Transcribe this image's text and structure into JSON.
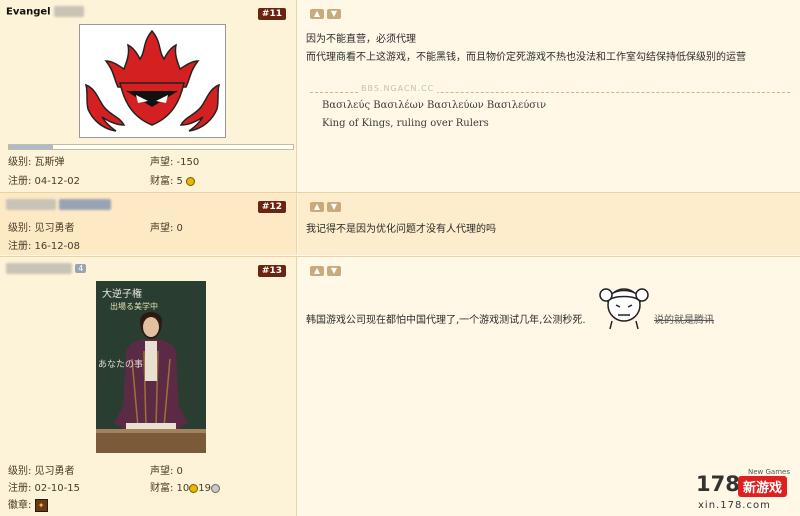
{
  "posts": [
    {
      "floor": "#11",
      "username": "Evangel",
      "level_label": "级别: 瓦斯弹",
      "reputation_label": "声望: -150",
      "register_label": "注册: 04-12-02",
      "wealth_label": "财富: 5",
      "content_lines": [
        "因为不能直营，必须代理",
        "而代理商看不上这游戏，不能黑钱，而且物价定死游戏不热也没法和工作室勾结保持低保级别的运营"
      ],
      "sig_watermark": "BBS.NGACN.CC",
      "signature_lines": [
        "Βασιλεύς Βασιλέων Βασιλεύων Βασιλεύσιν",
        "King of Kings, ruling over Rulers"
      ]
    },
    {
      "floor": "#12",
      "level_label": "级别: 见习勇者",
      "reputation_label": "声望: 0",
      "register_label": "注册: 16-12-08",
      "content_lines": [
        "我记得不是因为优化问题才没有人代理的吗"
      ]
    },
    {
      "floor": "#13",
      "user_badge": "4",
      "photo_board_text": [
        "大逆子権",
        "出場る美学中",
        "あなたの事"
      ],
      "level_label": "级别: 见习勇者",
      "reputation_label": "声望: 0",
      "register_label": "注册: 02-10-15",
      "wealth_label": "财富: 10",
      "wealth_label2": "19",
      "badge_label": "徽章:",
      "content_lines": [
        "韩国游戏公司现在都怕中国代理了,一个游戏测试几年,公测秒死."
      ],
      "strike_text": "说的就是腾讯"
    }
  ],
  "watermark": {
    "brand_num": "178",
    "brand_text": "新游戏",
    "tagline": "New Games",
    "url": "xin.178.com"
  },
  "colors": {
    "floor_badge": "#6b2410",
    "left_bg": "#fdf3d8",
    "right_bg": "#fff8e7",
    "logo_red": "#d42020"
  }
}
